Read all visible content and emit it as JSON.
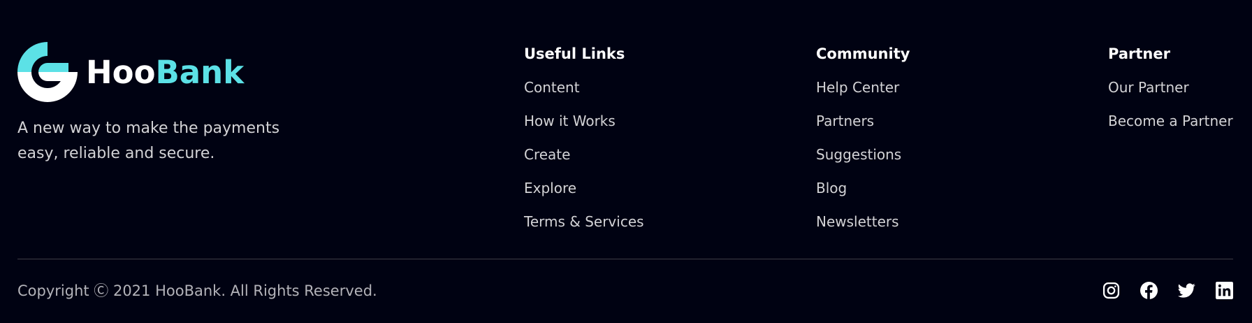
{
  "brand": {
    "logo_part1": "Hoo",
    "logo_part2": "Bank",
    "tagline": "A new way to make the payments easy, reliable and secure.",
    "accent_color": "#5ce1e6"
  },
  "columns": [
    {
      "title": "Useful Links",
      "links": [
        "Content",
        "How it Works",
        "Create",
        "Explore",
        "Terms & Services"
      ]
    },
    {
      "title": "Community",
      "links": [
        "Help Center",
        "Partners",
        "Suggestions",
        "Blog",
        "Newsletters"
      ]
    },
    {
      "title": "Partner",
      "links": [
        "Our Partner",
        "Become a Partner"
      ]
    }
  ],
  "copyright": "Copyright Ⓒ 2021 HooBank. All Rights Reserved.",
  "socials": [
    "instagram-icon",
    "facebook-icon",
    "twitter-icon",
    "linkedin-icon"
  ]
}
